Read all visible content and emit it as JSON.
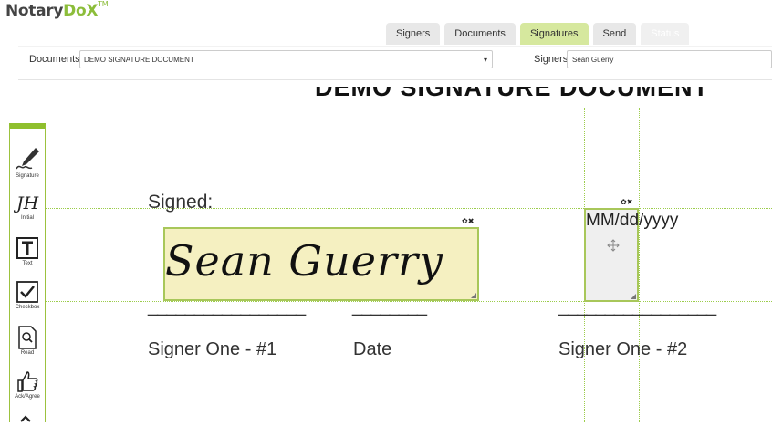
{
  "app": {
    "logo_main": "Notary",
    "logo_accent": "DoX",
    "logo_tm": "TM"
  },
  "tabs": [
    {
      "label": "Signers",
      "state": "normal"
    },
    {
      "label": "Documents",
      "state": "normal"
    },
    {
      "label": "Signatures",
      "state": "active"
    },
    {
      "label": "Send",
      "state": "normal"
    },
    {
      "label": "Status",
      "state": "disabled"
    }
  ],
  "toolbar": {
    "documents_label": "Documents",
    "documents_value": "DEMO SIGNATURE DOCUMENT",
    "signers_label": "Signers",
    "signers_value": "Sean Guerry"
  },
  "tools": [
    {
      "label": "Signature",
      "icon": "signature-pen-icon"
    },
    {
      "label": "Initial",
      "icon": "initial-icon"
    },
    {
      "label": "Text",
      "icon": "text-icon"
    },
    {
      "label": "Checkbox",
      "icon": "checkbox-icon"
    },
    {
      "label": "Read",
      "icon": "read-document-icon"
    },
    {
      "label": "Ack/Agree",
      "icon": "thumbs-up-icon"
    }
  ],
  "document": {
    "title": "DEMO SIGNATURE DOCUMENT",
    "signed_label": "Signed:",
    "signature_text": "Sean Guerry",
    "date_format": "MM/dd/yyyy",
    "line_1": "_________________",
    "line_2": "________",
    "line_3": "_________________",
    "caption_1": "Signer One - #1",
    "caption_2": "Date",
    "caption_3": "Signer One - #2"
  },
  "colors": {
    "accent": "#8fbf2d",
    "signature_fill": "#f5f0c1",
    "tab_active": "#d6e89e"
  }
}
